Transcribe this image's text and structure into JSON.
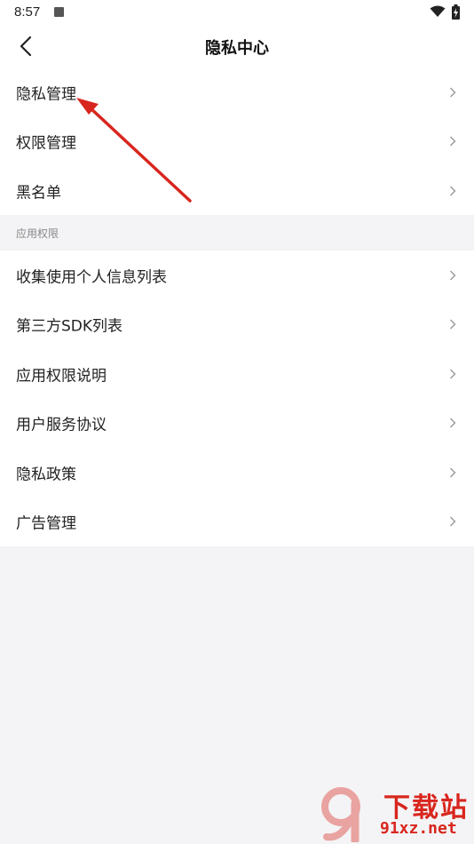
{
  "status_bar": {
    "time": "8:57"
  },
  "header": {
    "title": "隐私中心"
  },
  "group_main": [
    {
      "label": "隐私管理"
    },
    {
      "label": "权限管理"
    },
    {
      "label": "黑名单"
    }
  ],
  "section": {
    "label": "应用权限"
  },
  "group_permissions": [
    {
      "label": "收集使用个人信息列表"
    },
    {
      "label": "第三方SDK列表"
    },
    {
      "label": "应用权限说明"
    },
    {
      "label": "用户服务协议"
    },
    {
      "label": "隐私政策"
    },
    {
      "label": "广告管理"
    }
  ],
  "colors": {
    "background": "#f4f4f6",
    "surface": "#ffffff",
    "annotation_arrow": "#d8261e",
    "watermark": "#d8261e"
  },
  "icons": {
    "back": "chevron-left-icon",
    "row": "chevron-right-icon",
    "wifi": "wifi-icon",
    "battery": "battery-charging-icon"
  },
  "watermark": {
    "title": "下载站",
    "domain": "91xz.net"
  }
}
